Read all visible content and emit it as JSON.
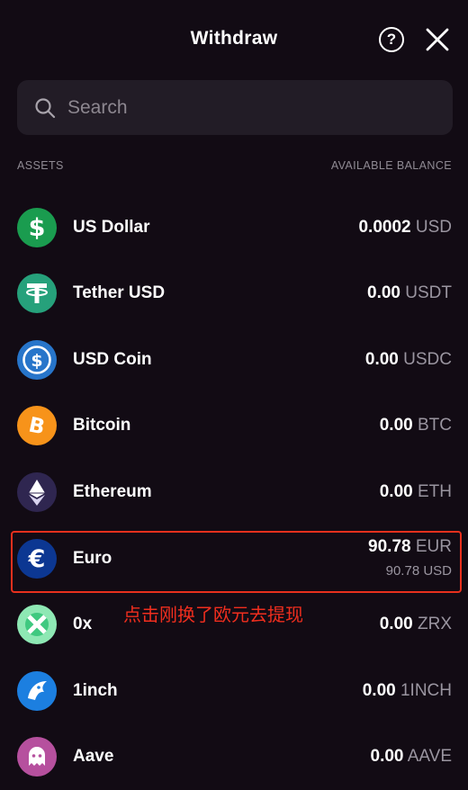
{
  "header": {
    "title": "Withdraw",
    "help_label": "?"
  },
  "search": {
    "placeholder": "Search"
  },
  "columns": {
    "assets": "ASSETS",
    "balance": "AVAILABLE BALANCE"
  },
  "assets": [
    {
      "name": "US Dollar",
      "amount": "0.0002",
      "unit": "USD",
      "icon": "usd-icon",
      "color": "#1a9c4f"
    },
    {
      "name": "Tether USD",
      "amount": "0.00",
      "unit": "USDT",
      "icon": "tether-icon",
      "color": "#26a17b"
    },
    {
      "name": "USD Coin",
      "amount": "0.00",
      "unit": "USDC",
      "icon": "usdc-icon",
      "color": "#2775ca"
    },
    {
      "name": "Bitcoin",
      "amount": "0.00",
      "unit": "BTC",
      "icon": "bitcoin-icon",
      "color": "#f7931a"
    },
    {
      "name": "Ethereum",
      "amount": "0.00",
      "unit": "ETH",
      "icon": "ethereum-icon",
      "color": "#2f2650"
    },
    {
      "name": "Euro",
      "amount": "90.78",
      "unit": "EUR",
      "sub_amount": "90.78 USD",
      "icon": "euro-icon",
      "color": "#0c3792"
    },
    {
      "name": "0x",
      "amount": "0.00",
      "unit": "ZRX",
      "icon": "zrx-icon",
      "color": "#8ee8b4"
    },
    {
      "name": "1inch",
      "amount": "0.00",
      "unit": "1INCH",
      "icon": "1inch-icon",
      "color": "#1c7fe0"
    },
    {
      "name": "Aave",
      "amount": "0.00",
      "unit": "AAVE",
      "icon": "aave-icon",
      "color": "#b6509e"
    }
  ],
  "annotation": "点击刚换了欧元去提现",
  "colors": {
    "background": "#120b14",
    "highlight": "#e8301d",
    "muted": "#9a95a0"
  }
}
